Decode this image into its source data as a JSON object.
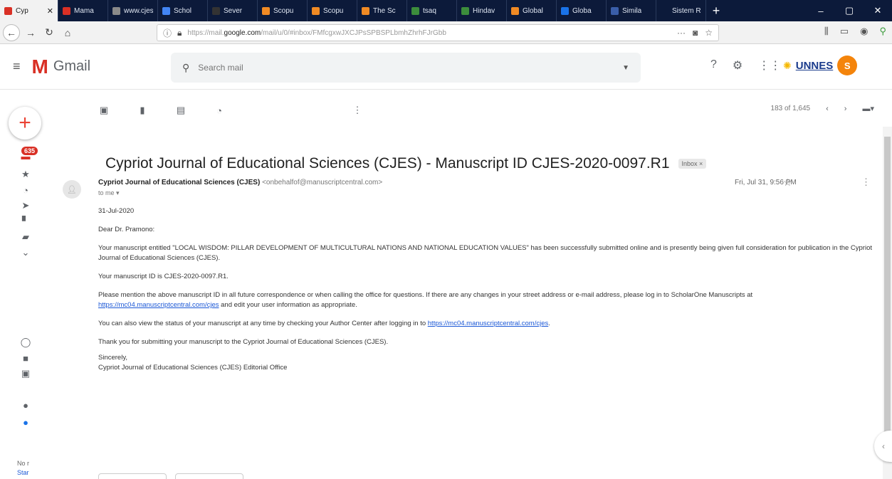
{
  "browser": {
    "tabs": [
      {
        "label": "Cyp",
        "color": "#d93025"
      },
      {
        "label": "Mama",
        "color": "#d93025"
      },
      {
        "label": "www.cjes",
        "color": "#8a8a8a"
      },
      {
        "label": "Schol",
        "color": "#4285f4"
      },
      {
        "label": "Sever",
        "color": "#333333"
      },
      {
        "label": "Scopu",
        "color": "#f08a24"
      },
      {
        "label": "Scopu",
        "color": "#f08a24"
      },
      {
        "label": "The Sc",
        "color": "#f08a24"
      },
      {
        "label": "tsaq",
        "color": "#3c8d3c"
      },
      {
        "label": "Hindav",
        "color": "#3c8d3c"
      },
      {
        "label": "Global",
        "color": "#f08a24"
      },
      {
        "label": "Globa",
        "color": "#1a73e8"
      },
      {
        "label": "Simila",
        "color": "#3a5ea8"
      },
      {
        "label": "Sistem Re",
        "color": "#0c1a3a"
      }
    ],
    "url_host": "https://mail.google.com",
    "url_path": "/mail/u/0/#inbox/FMfcgxwJXCJPsSPBSPLbmhZhrhFJrGbb",
    "url_prefix": "https://mail.",
    "url_domain": "google.com"
  },
  "gmail": {
    "app_name": "Gmail",
    "search_placeholder": "Search mail",
    "org_name": "UNNES",
    "avatar_letter": "S",
    "unread_badge": "635",
    "pagination": "183 of 1,645",
    "rail_bottom_label1": "No r",
    "rail_bottom_label2": "Star"
  },
  "message": {
    "subject": "Cypriot Journal of Educational Sciences (CJES) - Manuscript ID CJES-2020-0097.R1",
    "label": "Inbox ×",
    "sender_name": "Cypriot Journal of Educational Sciences (CJES)",
    "sender_email": "<onbehalfof@manuscriptcentral.com>",
    "to": "to me ▾",
    "date": "Fri, Jul 31, 9:56 PM",
    "body": {
      "p1": "31-Jul-2020",
      "p2": "Dear Dr. Pramono:",
      "p3": "Your manuscript entitled \"LOCAL WISDOM: PILLAR DEVELOPMENT OF MULTICULTURAL NATIONS AND NATIONAL EDUCATION VALUES\" has been successfully submitted online and is presently being given full consideration for publication in the Cypriot Journal of Educational Sciences (CJES).",
      "p4": "Your manuscript ID is CJES-2020-0097.R1.",
      "p5a": "Please mention the above manuscript ID in all future correspondence or when calling the office for questions. If there are any changes in your street address or e-mail address, please log in to ScholarOne Manuscripts at ",
      "p5link": "https://mc04.manuscriptcentral.com/cjes",
      "p5b": " and edit your user information as appropriate.",
      "p6a": "You can also view the status of your manuscript at any time by checking your Author Center after logging in to ",
      "p6link": "https://mc04.manuscriptcentral.com/cjes",
      "p6b": ".",
      "p7": "Thank you for submitting your manuscript to the Cypriot Journal of Educational Sciences (CJES).",
      "sig1": "Sincerely,",
      "sig2": "Cypriot Journal of Educational Sciences (CJES) Editorial Office"
    }
  }
}
